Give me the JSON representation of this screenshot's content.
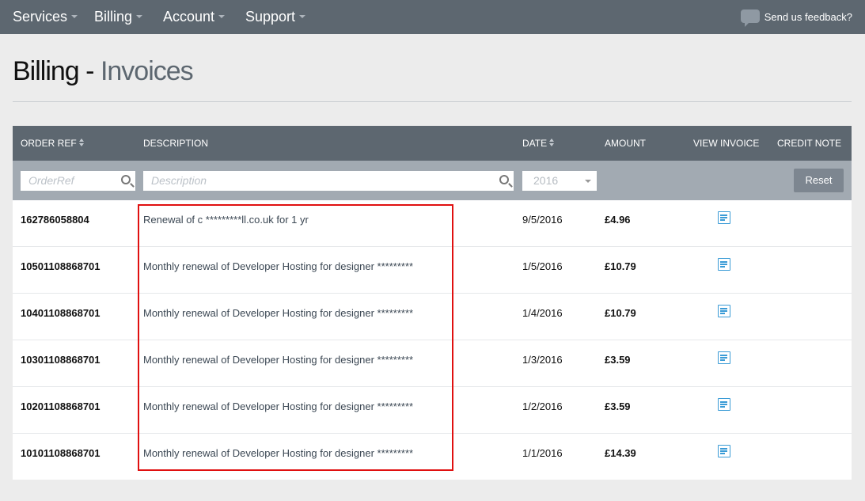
{
  "nav": {
    "items": [
      {
        "label": "Services"
      },
      {
        "label": "Billing"
      },
      {
        "label": "Account"
      },
      {
        "label": "Support"
      }
    ],
    "feedback_label": "Send us feedback?"
  },
  "page": {
    "title_main": "Billing -",
    "title_sub": "Invoices"
  },
  "table": {
    "headers": {
      "order_ref": "ORDER REF",
      "description": "DESCRIPTION",
      "date": "DATE",
      "amount": "AMOUNT",
      "view_invoice": "VIEW INVOICE",
      "credit_note": "CREDIT NOTE"
    },
    "filters": {
      "order_ref_placeholder": "OrderRef",
      "description_placeholder": "Description",
      "year_value": "2016",
      "reset_label": "Reset"
    },
    "rows": [
      {
        "order_ref": "162786058804",
        "description": "Renewal of c *********ll.co.uk for 1 yr",
        "date": "9/5/2016",
        "amount": "£4.96"
      },
      {
        "order_ref": "10501108868701",
        "description": "Monthly renewal of Developer Hosting for designer *********",
        "date": "1/5/2016",
        "amount": "£10.79"
      },
      {
        "order_ref": "10401108868701",
        "description": "Monthly renewal of Developer Hosting for designer *********",
        "date": "1/4/2016",
        "amount": "£10.79"
      },
      {
        "order_ref": "10301108868701",
        "description": "Monthly renewal of Developer Hosting for designer *********",
        "date": "1/3/2016",
        "amount": "£3.59"
      },
      {
        "order_ref": "10201108868701",
        "description": "Monthly renewal of Developer Hosting for designer *********",
        "date": "1/2/2016",
        "amount": "£3.59"
      },
      {
        "order_ref": "10101108868701",
        "description": "Monthly renewal of Developer Hosting for designer *********",
        "date": "1/1/2016",
        "amount": "£14.39"
      }
    ]
  },
  "colors": {
    "nav_bg": "#5d6770",
    "filter_bg": "#a2aab2",
    "icon_blue": "#3a9bd6",
    "highlight": "#e01010"
  }
}
